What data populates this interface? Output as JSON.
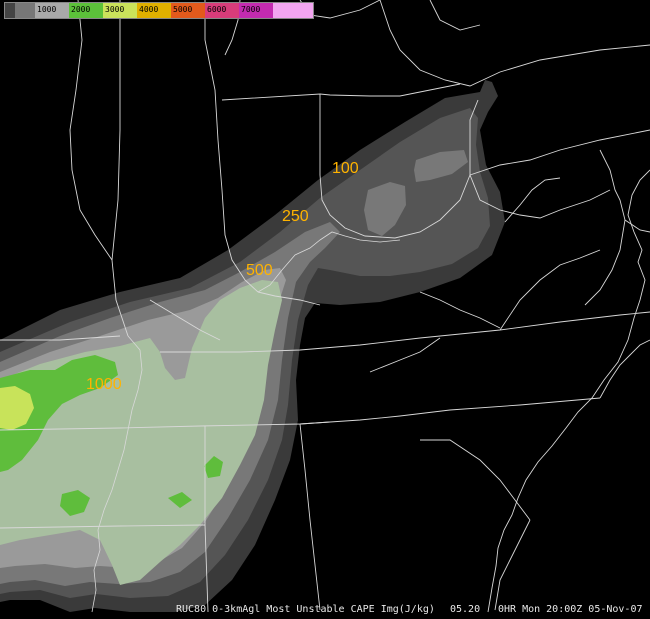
{
  "colorbar": {
    "segments": [
      {
        "color": "#444444",
        "label": ""
      },
      {
        "color": "#777777",
        "label": ""
      },
      {
        "color": "#a9a9a9",
        "label": "1000"
      },
      {
        "color": "#5cc13a",
        "label": "2000"
      },
      {
        "color": "#cbe35b",
        "label": "3000"
      },
      {
        "color": "#e0b000",
        "label": "4000"
      },
      {
        "color": "#e25a1c",
        "label": "5000"
      },
      {
        "color": "#d83c7a",
        "label": "6000"
      },
      {
        "color": "#c32bb0",
        "label": "7000"
      },
      {
        "color": "#f2a5f0",
        "label": ""
      }
    ]
  },
  "contour_labels": {
    "c100": "100",
    "c250": "250",
    "c500": "500",
    "c1000": "1000"
  },
  "fill_colors": {
    "lt100": "#3a3a3a",
    "c100": "#555555",
    "c250": "#787878",
    "c500": "#9a9a9a",
    "c1000": "#a8bfa0",
    "c2000": "#5fbd3c",
    "c3000": "#c8e35a",
    "label": "#ffb300",
    "boundary": "#d8d8d8"
  },
  "footer": {
    "product": "RUC80 0-3kmAgl Most Unstable CAPE Img(J/kg)",
    "frame": "05.20",
    "run": "0HR Mon 20:00Z 05-Nov-07"
  }
}
